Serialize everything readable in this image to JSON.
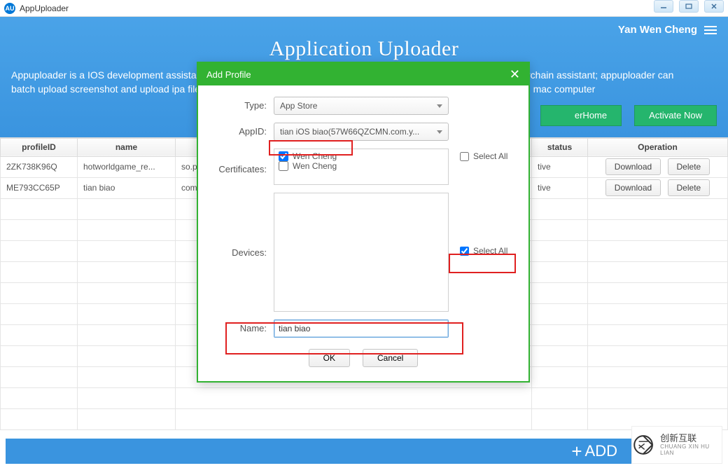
{
  "window": {
    "title": "AppUploader",
    "logo_text": "AU"
  },
  "header": {
    "user_name": "Yan Wen Cheng",
    "main_title": "Application Uploader",
    "description": "Appuploader is a IOS development assistant, it can help you create ios development & push certificate, do not need keychain assistant; appuploader can batch upload screenshot and upload ipa file to apple store on windows, linux or mac, do not need application loader and mac computer",
    "button_home_suffix": "erHome",
    "button_activate": "Activate Now"
  },
  "table": {
    "headers": {
      "profileID": "profileID",
      "name": "name",
      "appID": "",
      "status": "status",
      "operation": "Operation"
    },
    "rows": [
      {
        "profileID": "2ZK738K96Q",
        "name": "hotworldgame_re...",
        "appID": "so.phone",
        "status_suffix": "tive"
      },
      {
        "profileID": "ME793CC65P",
        "name": "tian biao",
        "appID": "com.yesg",
        "status_suffix": "tive"
      }
    ],
    "download_label": "Download",
    "delete_label": "Delete"
  },
  "modal": {
    "title": "Add Profile",
    "labels": {
      "type": "Type:",
      "appID": "AppID:",
      "certificates": "Certificates:",
      "devices": "Devices:",
      "name": "Name:"
    },
    "type_value": "App Store",
    "appid_value": "tian iOS biao(57W66QZCMN.com.y...",
    "cert_options": [
      {
        "label": "Wen Cheng",
        "checked": true
      },
      {
        "label": "Wen Cheng",
        "checked": false
      }
    ],
    "cert_selectall": "Select All",
    "dev_selectall": "Select All",
    "name_value": "tian biao",
    "ok_label": "OK",
    "cancel_label": "Cancel"
  },
  "footer": {
    "add_text": "ADD"
  },
  "watermark": {
    "brand_cn": "创新互联",
    "brand_py": "CHUANG XIN HU LIAN"
  }
}
